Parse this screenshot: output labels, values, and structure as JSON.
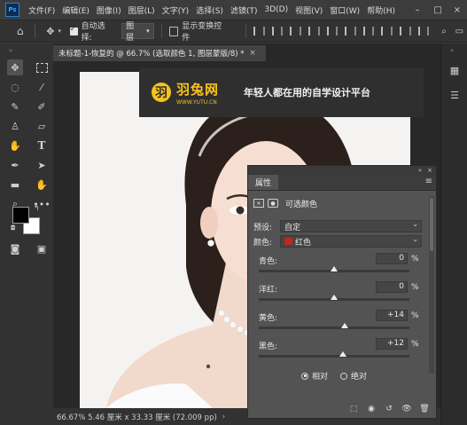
{
  "menubar": {
    "logo": "Ps",
    "items": [
      "文件(F)",
      "编辑(E)",
      "图像(I)",
      "图层(L)",
      "文字(Y)",
      "选择(S)",
      "滤镜(T)",
      "3D(D)",
      "视图(V)",
      "窗口(W)",
      "帮助(H)"
    ],
    "controls": [
      "–",
      "□",
      "×"
    ]
  },
  "optionsbar": {
    "auto_select_label": "自动选择:",
    "auto_select_checked": true,
    "target_value": "图层",
    "show_transform_label": "显示变换控件",
    "show_transform_checked": false
  },
  "tab": {
    "title": "未标题-1-恢复的 @ 66.7% (选取颜色 1, 图层蒙版/8) *",
    "close": "×"
  },
  "banner": {
    "logo_char": "羽",
    "brand": "羽兔网",
    "url": "WWW.YUTU.CN",
    "slogan": "年轻人都在用的自学设计平台"
  },
  "statusbar": {
    "text": "66.67%  5.46 厘米 x 33.33 厘米 (72.009 pp)",
    "arrow": "›"
  },
  "properties": {
    "title": "属性",
    "adjustment_name": "可选颜色",
    "preset_label": "预设:",
    "preset_value": "自定",
    "colors_label": "颜色:",
    "colors_value": "红色",
    "colors_swatch": "#c0271d",
    "sliders": [
      {
        "label": "青色:",
        "value": "0",
        "unit": "%",
        "position": 0.5
      },
      {
        "label": "洋红:",
        "value": "0",
        "unit": "%",
        "position": 0.5
      },
      {
        "label": "黄色:",
        "value": "+14",
        "unit": "%",
        "position": 0.57
      },
      {
        "label": "黑色:",
        "value": "+12",
        "unit": "%",
        "position": 0.56
      }
    ],
    "method_relative": "相对",
    "method_absolute": "绝对",
    "method_selected": "relative"
  },
  "colors": {
    "accent": "#f7c31d",
    "foreground": "#000000",
    "background": "#ffffff"
  }
}
